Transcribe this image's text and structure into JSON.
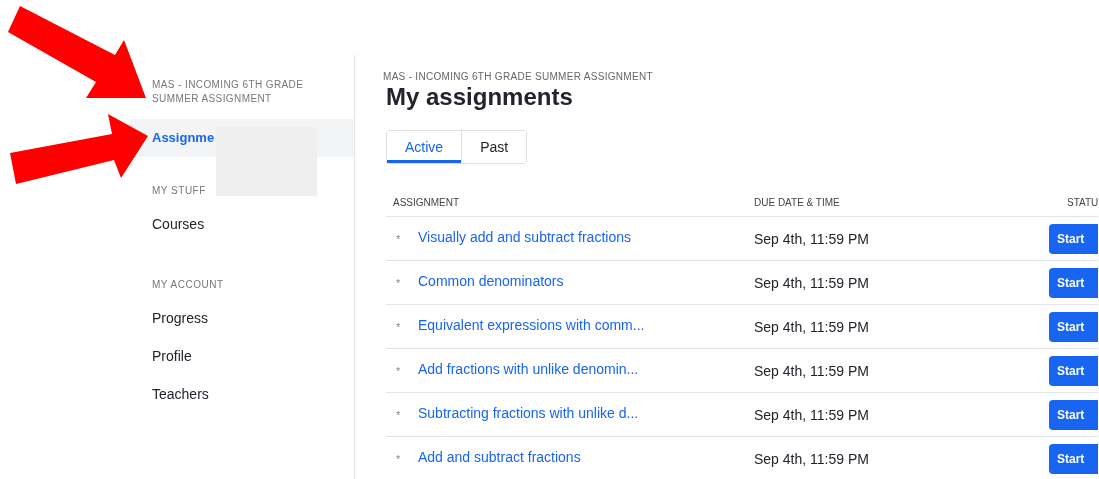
{
  "sidebar": {
    "course_title": "MAS - INCOMING 6TH GRADE SUMMER ASSIGNMENT",
    "items": [
      {
        "kind": "link",
        "label": "Assignme",
        "selected": true
      },
      {
        "kind": "heading",
        "label": "MY STUFF"
      },
      {
        "kind": "link",
        "label": "Courses",
        "selected": false
      },
      {
        "kind": "heading",
        "label": "MY ACCOUNT"
      },
      {
        "kind": "link",
        "label": "Progress",
        "selected": false
      },
      {
        "kind": "link",
        "label": "Profile",
        "selected": false
      },
      {
        "kind": "link",
        "label": "Teachers",
        "selected": false
      }
    ]
  },
  "main": {
    "breadcrumb": "MAS - INCOMING 6TH GRADE SUMMER ASSIGNMENT",
    "title": "My assignments",
    "tabs": [
      {
        "label": "Active",
        "selected": true
      },
      {
        "label": "Past",
        "selected": false
      }
    ],
    "table": {
      "columns": [
        "ASSIGNMENT",
        "DUE DATE & TIME",
        "STATU"
      ],
      "rows": [
        {
          "marker": "*",
          "title": "Visually add and subtract fractions",
          "due": "Sep 4th, 11:59 PM",
          "action": "Start"
        },
        {
          "marker": "*",
          "title": "Common denominators",
          "due": "Sep 4th, 11:59 PM",
          "action": "Start"
        },
        {
          "marker": "*",
          "title": "Equivalent expressions with comm...",
          "due": "Sep 4th, 11:59 PM",
          "action": "Start"
        },
        {
          "marker": "*",
          "title": "Add fractions with unlike denomin...",
          "due": "Sep 4th, 11:59 PM",
          "action": "Start"
        },
        {
          "marker": "*",
          "title": "Subtracting fractions with unlike d...",
          "due": "Sep 4th, 11:59 PM",
          "action": "Start"
        },
        {
          "marker": "*",
          "title": "Add and subtract fractions",
          "due": "Sep 4th, 11:59 PM",
          "action": "Start"
        }
      ]
    }
  }
}
